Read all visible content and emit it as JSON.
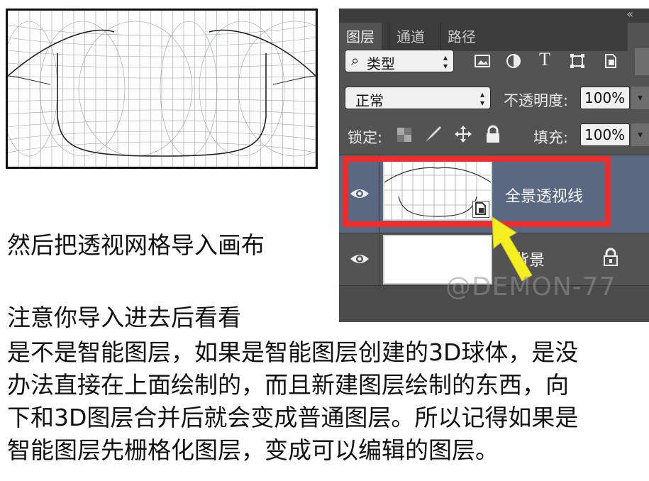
{
  "captions": {
    "line1": "然后把透视网格导入画布",
    "line2": "注意你导入进去后看看",
    "paragraph": [
      "是不是智能图层，如果是智能图层创建的3D球体，是没",
      "办法直接在上面绘制的，而且新建图层绘制的东西，向",
      "下和3D图层合并后就会变成普通图层。所以记得如果是",
      "智能图层先栅格化图层，变成可以编辑的图层。"
    ]
  },
  "panel": {
    "collapse_glyph": "«",
    "tabs": [
      "图层",
      "通道",
      "路径"
    ],
    "filter": {
      "search_glyph": "⌕",
      "value": "类型"
    },
    "filter_icons": [
      "image-filter-icon",
      "adjustment-filter-icon",
      "text-filter-icon",
      "shape-filter-icon",
      "smart-object-filter-icon"
    ],
    "text_filter_glyph": "T",
    "blend_mode": "正常",
    "opacity_label": "不透明度:",
    "opacity_value": "100%",
    "lock_label": "锁定:",
    "fill_label": "填充:",
    "fill_value": "100%",
    "layers": [
      {
        "name": "全景透视线",
        "selected": true
      },
      {
        "name": "背景",
        "locked": true
      }
    ]
  },
  "watermark": "@DEMON-77",
  "colors": {
    "panel_bg": "#535353",
    "selected_row": "#5a6981",
    "highlight_red": "#ee2c2c",
    "arrow_yellow": "#f5ef22"
  }
}
